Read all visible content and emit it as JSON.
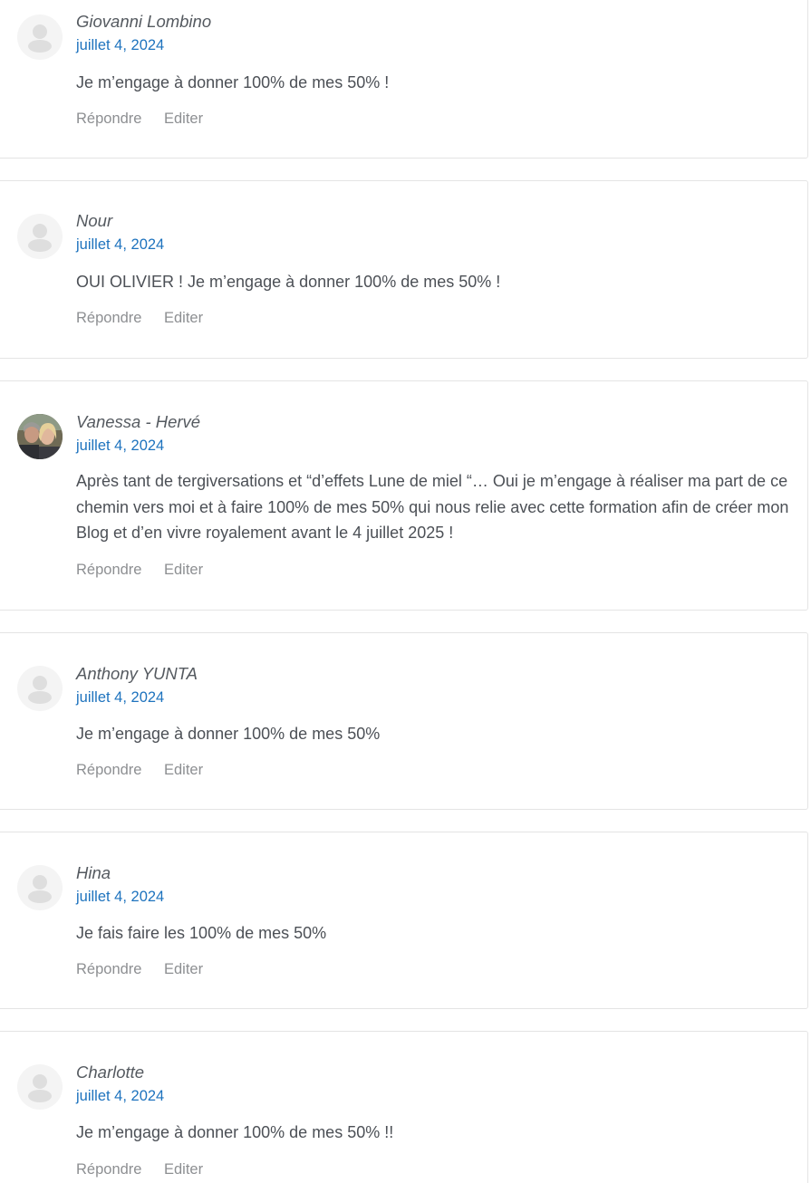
{
  "comments": [
    {
      "author": "Giovanni Lombino",
      "date": "juillet 4, 2024",
      "text": "Je m’engage à donner 100% de mes 50% !",
      "reply_label": "Répondre",
      "edit_label": "Editer",
      "avatar": "default-avatar-icon"
    },
    {
      "author": "Nour",
      "date": "juillet 4, 2024",
      "text": "OUI OLIVIER ! Je m’engage à donner 100% de mes 50% !",
      "reply_label": "Répondre",
      "edit_label": "Editer",
      "avatar": "default-avatar-icon"
    },
    {
      "author": "Vanessa - Hervé",
      "date": "juillet 4, 2024",
      "text": "Après tant de tergiversations et “d’effets Lune de miel “… Oui je m’engage à réaliser ma part de ce chemin vers moi et à faire 100% de mes 50% qui nous relie avec cette formation afin de créer mon Blog et d’en vivre royalement avant le 4 juillet 2025 !",
      "reply_label": "Répondre",
      "edit_label": "Editer",
      "avatar": "photo-avatar"
    },
    {
      "author": "Anthony YUNTA",
      "date": "juillet 4, 2024",
      "text": "Je m’engage à donner 100% de mes 50%",
      "reply_label": "Répondre",
      "edit_label": "Editer",
      "avatar": "default-avatar-icon"
    },
    {
      "author": "Hina",
      "date": "juillet 4, 2024",
      "text": "Je fais faire les 100% de mes 50%",
      "reply_label": "Répondre",
      "edit_label": "Editer",
      "avatar": "default-avatar-icon"
    },
    {
      "author": "Charlotte",
      "date": "juillet 4, 2024",
      "text": "Je m’engage à donner 100% de mes 50% !!",
      "reply_label": "Répondre",
      "edit_label": "Editer",
      "avatar": "default-avatar-icon"
    }
  ],
  "colors": {
    "date_link": "#1e73be",
    "author": "#555a60",
    "body_text": "#4c5056",
    "action_text": "#8d8f92",
    "card_border": "#e4e4e4",
    "avatar_bg": "#f4f4f4"
  }
}
